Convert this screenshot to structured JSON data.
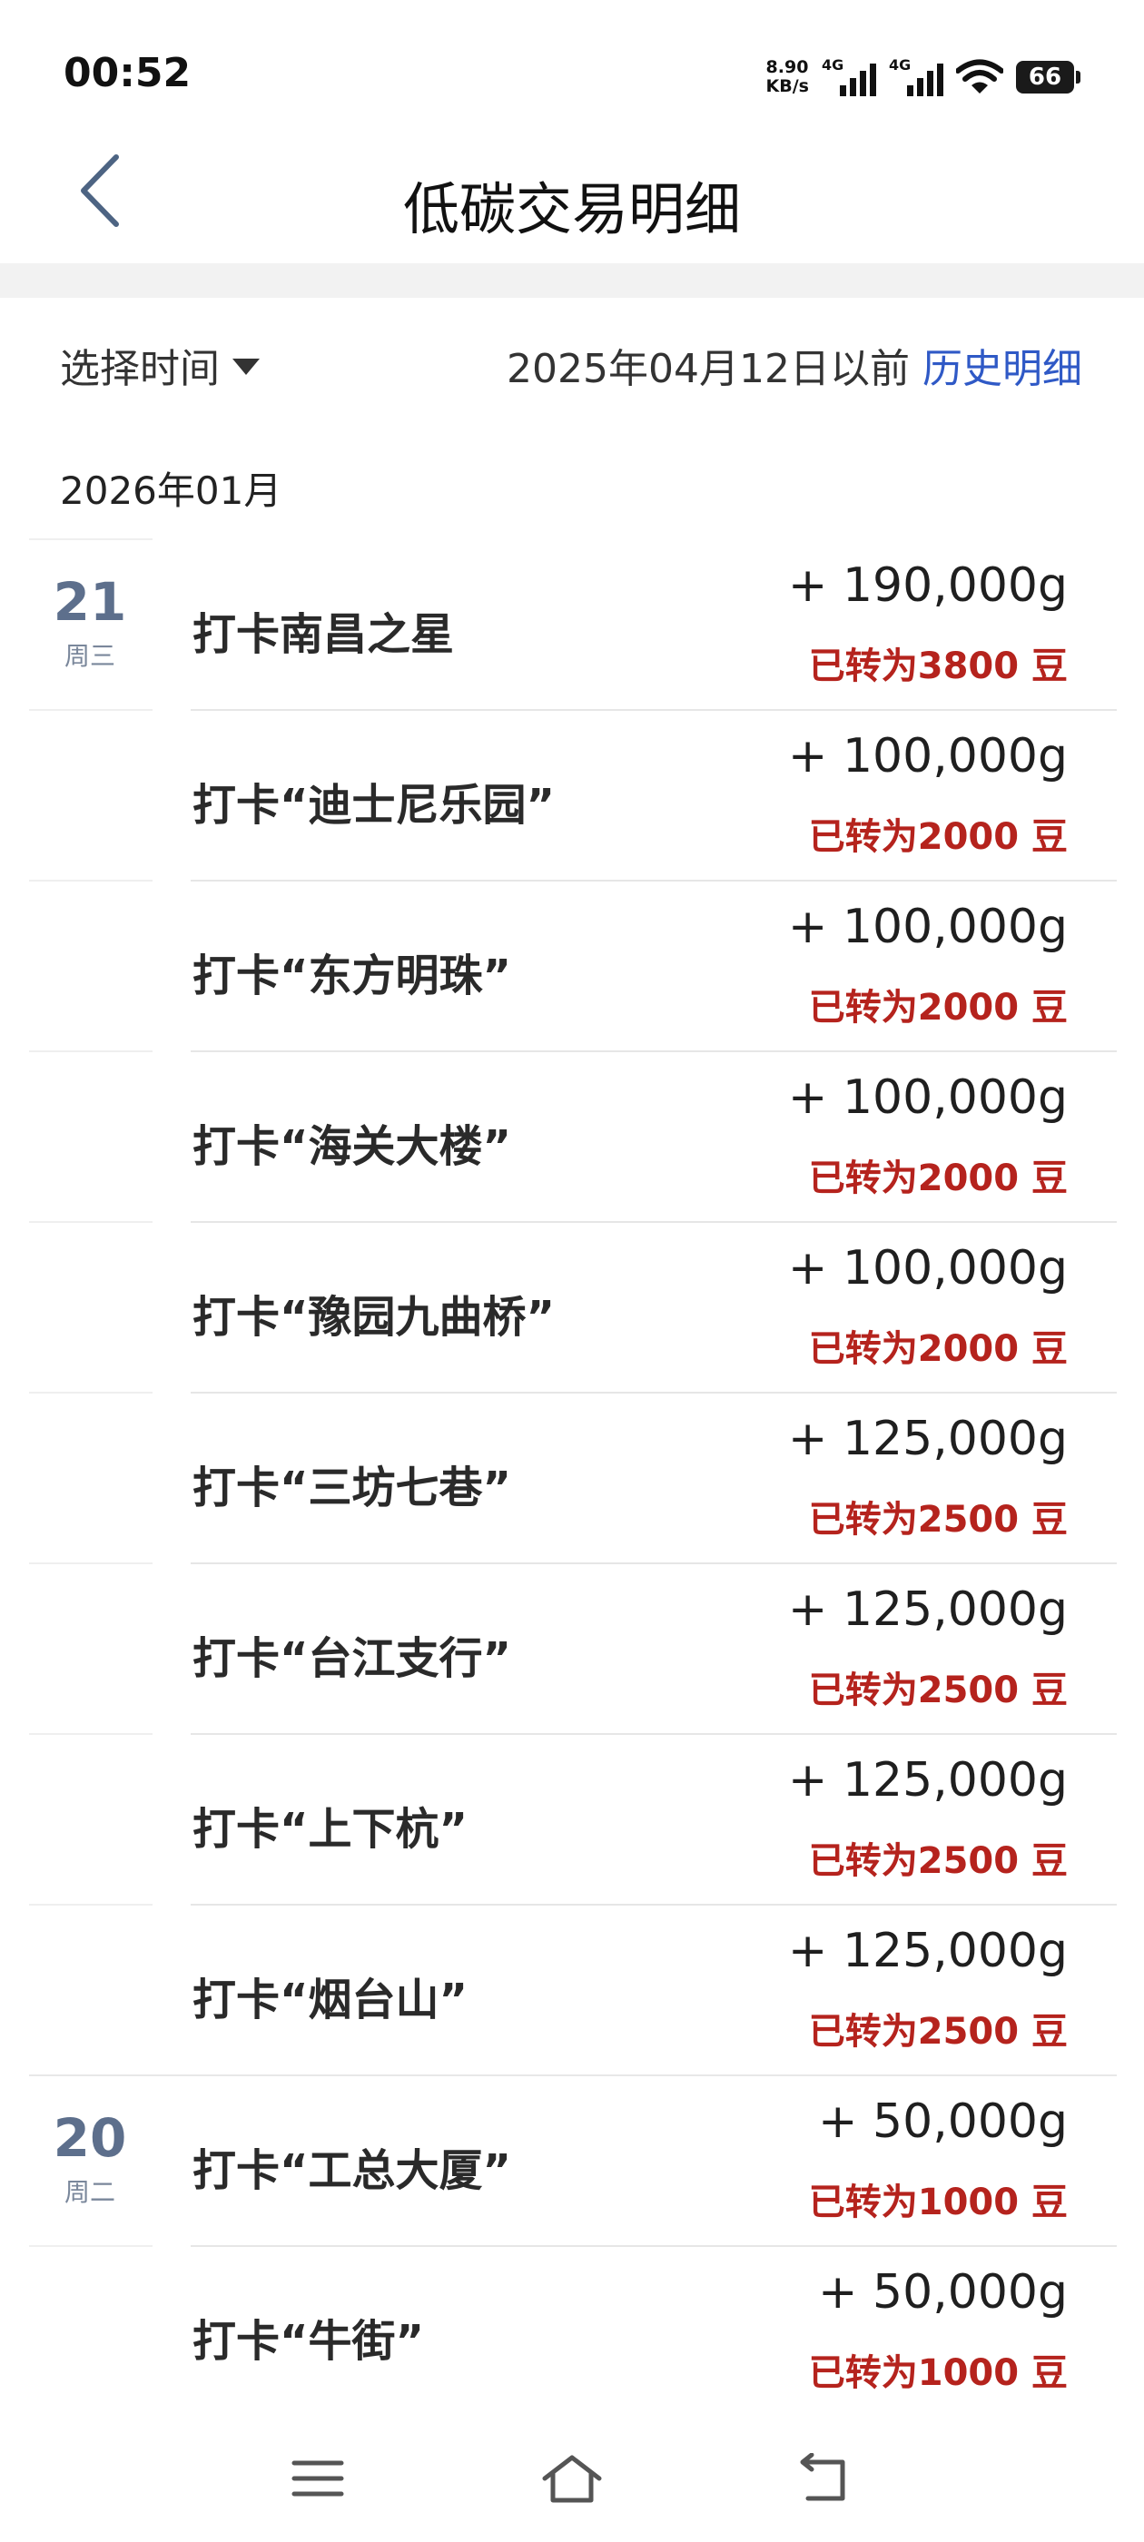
{
  "status_bar": {
    "time": "00:52",
    "net_speed_value": "8.90",
    "net_speed_unit": "KB/s",
    "signal1_label": "4G",
    "signal2_label": "4G",
    "battery": "66"
  },
  "header": {
    "title": "低碳交易明细",
    "back_icon": "chevron-left-icon"
  },
  "filter": {
    "select_time_label": "选择时间",
    "before_date_text": "2025年04月12日以前",
    "history_link": "历史明细"
  },
  "month_label": "2026年01月",
  "days": [
    {
      "day": "21",
      "weekday": "周三"
    },
    {
      "day": "20",
      "weekday": "周二"
    }
  ],
  "records": [
    {
      "name": "打卡南昌之星",
      "amount": "+ 190,000g",
      "beans": "已转为3800 豆"
    },
    {
      "name": "打卡“迪士尼乐园”",
      "amount": "+ 100,000g",
      "beans": "已转为2000 豆"
    },
    {
      "name": "打卡“东方明珠”",
      "amount": "+ 100,000g",
      "beans": "已转为2000 豆"
    },
    {
      "name": "打卡“海关大楼”",
      "amount": "+ 100,000g",
      "beans": "已转为2000 豆"
    },
    {
      "name": "打卡“豫园九曲桥”",
      "amount": "+ 100,000g",
      "beans": "已转为2000 豆"
    },
    {
      "name": "打卡“三坊七巷”",
      "amount": "+ 125,000g",
      "beans": "已转为2500 豆"
    },
    {
      "name": "打卡“台江支行”",
      "amount": "+ 125,000g",
      "beans": "已转为2500 豆"
    },
    {
      "name": "打卡“上下杭”",
      "amount": "+ 125,000g",
      "beans": "已转为2500 豆"
    },
    {
      "name": "打卡“烟台山”",
      "amount": "+ 125,000g",
      "beans": "已转为2500 豆"
    },
    {
      "name": "打卡“工总大厦”",
      "amount": "+ 50,000g",
      "beans": "已转为1000 豆"
    },
    {
      "name": "打卡“牛街”",
      "amount": "+ 50,000g",
      "beans": "已转为1000 豆"
    }
  ],
  "nav_bar": {
    "menu_icon": "menu-icon",
    "home_icon": "home-icon",
    "back_icon": "back-icon"
  },
  "colors": {
    "accent_link": "#2f59c6",
    "beans_red": "#b5231d",
    "day_number": "#5d6f8c"
  }
}
